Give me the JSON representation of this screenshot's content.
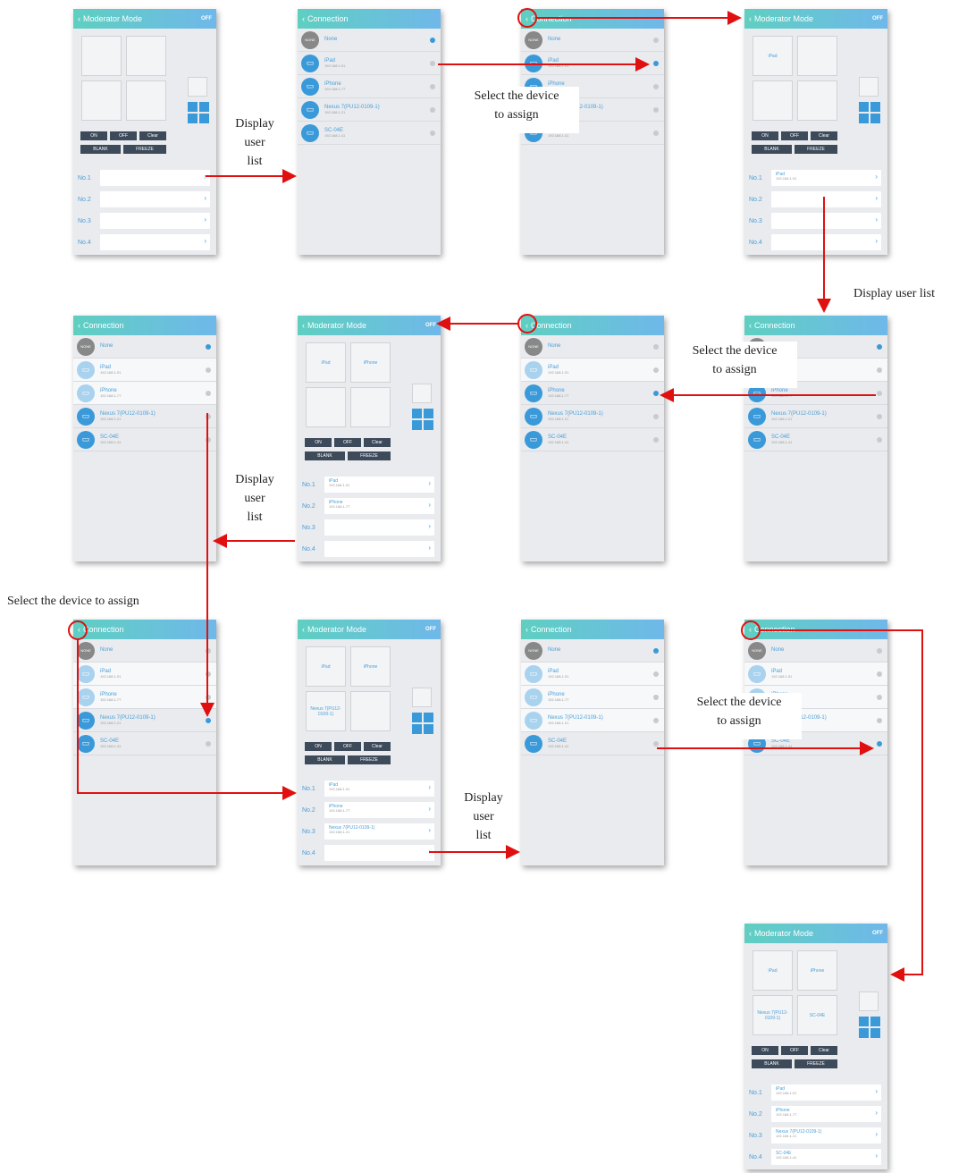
{
  "moderator": {
    "title": "Moderator Mode",
    "toggle": "OFF",
    "on": "ON",
    "off": "OFF",
    "clear": "Clear",
    "blank": "BLANK",
    "freeze": "FREEZE",
    "slots": [
      "No.1",
      "No.2",
      "No.3",
      "No.4"
    ]
  },
  "connection": {
    "title": "Connection"
  },
  "devices": [
    {
      "name": "None",
      "ip": ""
    },
    {
      "name": "iPad",
      "ip": "192.168.1.91"
    },
    {
      "name": "iPhone",
      "ip": "192.168.1.77"
    },
    {
      "name": "Nexus 7(PU12-0109-1)",
      "ip": "192.168.1.21"
    },
    {
      "name": "SC-04E",
      "ip": "192.168.1.41"
    }
  ],
  "avatar_none": "NONE",
  "quad_nexus": "Nexus 7(PU12-0109-1)",
  "notes": {
    "display": "Display user list",
    "select": "Select the device to assign",
    "display_l1": "Display",
    "display_l2": "user",
    "display_l3": "list",
    "select_l1": "Select the device",
    "select_l2": "to assign"
  },
  "colors": {
    "arrow": "#e01010",
    "accent": "#3a9ad9",
    "header_start": "#5fcfc1",
    "header_end": "#6fb8ea"
  }
}
